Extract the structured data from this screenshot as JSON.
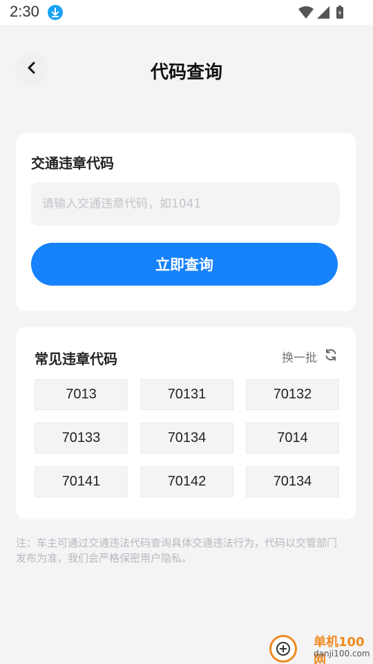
{
  "status_bar": {
    "time": "2:30"
  },
  "header": {
    "title": "代码查询"
  },
  "search_card": {
    "label": "交通违章代码",
    "input_placeholder": "请输入交通违章代码，如1041",
    "input_value": "",
    "button_label": "立即查询"
  },
  "common_card": {
    "title": "常见违章代码",
    "refresh_label": "换一批",
    "codes": [
      "7013",
      "70131",
      "70132",
      "70133",
      "70134",
      "7014",
      "70141",
      "70142",
      "70134"
    ]
  },
  "note": "注：车主可通过交通违法代码查询具体交通违法行为，代码以交管部门发布为准，我们会严格保密用户隐私。",
  "watermark": {
    "line1": "单机100网",
    "line2": "danji100.com"
  },
  "colors": {
    "accent": "#1682fb",
    "background": "#f4f4f6",
    "watermark": "#f08a1e"
  }
}
